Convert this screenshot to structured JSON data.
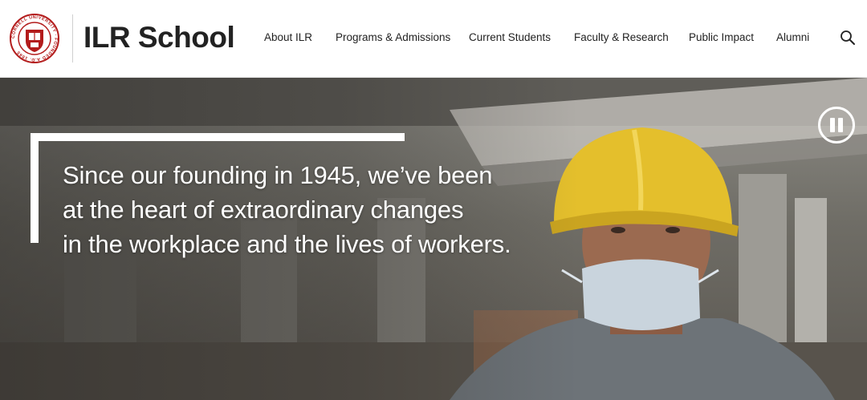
{
  "header": {
    "seal": {
      "ring_text": "CORNELL UNIVERSITY · FOUNDED A.D. 1865",
      "color": "#b31b1b"
    },
    "site_title": "ILR School",
    "nav": [
      {
        "label": "About ILR"
      },
      {
        "label": "Programs & Admissions"
      },
      {
        "label": "Current Students"
      },
      {
        "label": "Faculty & Research"
      },
      {
        "label": "Public Impact"
      },
      {
        "label": "Alumni"
      }
    ],
    "search_icon": "search-icon"
  },
  "hero": {
    "quote_lines": [
      "Since our founding in 1945, we’ve been",
      "at the heart of extraordinary changes",
      "in the workplace and the lives of workers."
    ],
    "pause_icon": "pause-icon",
    "accent": "#ffffff"
  }
}
